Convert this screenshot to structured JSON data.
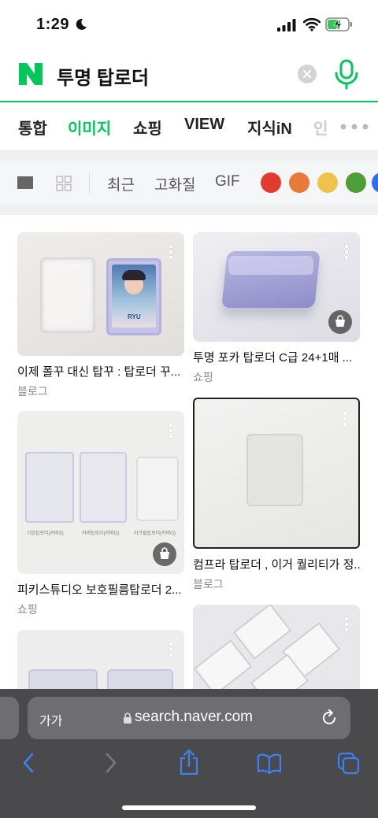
{
  "status_bar": {
    "time": "1:29"
  },
  "search": {
    "logo": "N",
    "query": "투명 탑로더"
  },
  "tabs": [
    "통합",
    "이미지",
    "쇼핑",
    "VIEW",
    "지식iN",
    "인"
  ],
  "filters": {
    "sort_recent": "최근",
    "high_quality": "고화질",
    "gif": "GIF",
    "color_swatches": [
      "#e03b2e",
      "#e87a38",
      "#efc24b",
      "#4f9e35",
      "#2f6ef0"
    ]
  },
  "results": [
    {
      "title": "이제 폴꾸 대신 탑꾸 : 탑로더 꾸...",
      "source": "블로그",
      "shopping": false
    },
    {
      "title": "투명 포카 탑로더 C급 24+1매 ...",
      "source": "쇼핑",
      "shopping": true
    },
    {
      "title": "피키스튜디오 보호필름탑로더 2...",
      "source": "쇼핑",
      "shopping": true
    },
    {
      "title": "컴프라 탑로더 , 이거 퀄리티가 정...",
      "source": "블로그",
      "shopping": false
    }
  ],
  "result3_labels": [
    "기본탑로더(커버X)",
    "커버탑로더(커버O)",
    "아크릴탑로더(커버O)"
  ],
  "result1_photo_text": "RYU",
  "browser": {
    "text_size": "가가",
    "url": "search.naver.com"
  },
  "colors": {
    "naver_green": "#03c75a"
  }
}
